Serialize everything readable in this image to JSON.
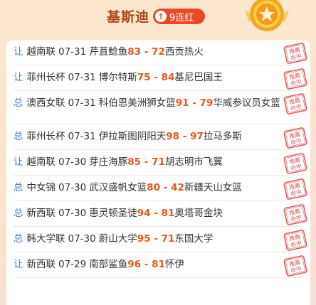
{
  "header": {
    "expert_name": "基斯迪",
    "streak_label": "9连红"
  },
  "stamp_text": "推薦命中",
  "colors": {
    "accent": "#e84a28",
    "score": "#e8551f",
    "type_label": "#4a7fcf"
  },
  "picks": [
    {
      "type": "让",
      "league": "越南联",
      "date": "07-31",
      "home": "芹苴鲶鱼",
      "home_score": "83",
      "sep": " - ",
      "away_score": "72",
      "away": "西贡热火"
    },
    {
      "type": "让",
      "league": "菲州长杯",
      "date": "07-31",
      "home": "博尔特斯",
      "home_score": "75",
      "sep": " - ",
      "away_score": "84",
      "away": "基尼巴国王"
    },
    {
      "type": "总",
      "league": "澳西女联",
      "date": "07-31",
      "home": "科伯恩美洲狮女篮",
      "home_score": "91",
      "sep": " - ",
      "away_score": "79",
      "away": "华威参议员女篮"
    },
    {
      "type": "总",
      "league": "菲州长杯",
      "date": "07-31",
      "home": "伊拉斯图阴阳天",
      "home_score": "98",
      "sep": " - ",
      "away_score": "97",
      "away": "拉马多斯"
    },
    {
      "type": "让",
      "league": "越南联",
      "date": "07-30",
      "home": "芽庄海豚",
      "home_score": "85",
      "sep": " - ",
      "away_score": "71",
      "away": "胡志明市飞翼"
    },
    {
      "type": "总",
      "league": "中女锦",
      "date": "07-30",
      "home": "武汉盛帆女篮",
      "home_score": "80",
      "sep": " - ",
      "away_score": "42",
      "away": "新疆天山女篮"
    },
    {
      "type": "总",
      "league": "新西联",
      "date": "07-30",
      "home": "惠灵顿圣徒",
      "home_score": "94",
      "sep": " - ",
      "away_score": "81",
      "away": "奥塔哥金块"
    },
    {
      "type": "总",
      "league": "韩大学联",
      "date": "07-30",
      "home": "蔚山大学",
      "home_score": "95",
      "sep": " - ",
      "away_score": "71",
      "away": "东国大学"
    },
    {
      "type": "让",
      "league": "新西联",
      "date": "07-29",
      "home": "南部鲨鱼",
      "home_score": "96",
      "sep": " - ",
      "away_score": "81",
      "away": "怀伊"
    }
  ]
}
